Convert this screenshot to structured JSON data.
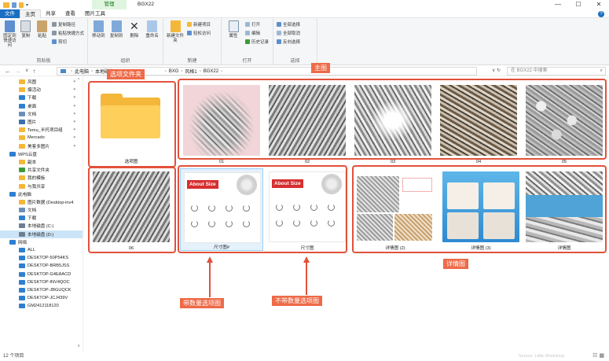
{
  "window": {
    "title": "BGX22",
    "context_tab": "管理",
    "controls": [
      "—",
      "☐",
      "✕"
    ]
  },
  "ribbon_tabs": [
    "文件",
    "主页",
    "共享",
    "查看",
    "图片工具"
  ],
  "ribbon": {
    "clipboard": {
      "label": "剪贴板",
      "big": [
        "固定到快速访问",
        "复制",
        "粘贴"
      ],
      "small": [
        "复制路径",
        "粘贴快捷方式",
        "剪切"
      ]
    },
    "organize": {
      "label": "组织",
      "big": [
        "移动到",
        "复制到",
        "删除",
        "重命名"
      ]
    },
    "new": {
      "label": "新建",
      "big": [
        "新建文件夹"
      ],
      "small": [
        "新建项目",
        "轻松访问"
      ]
    },
    "open": {
      "label": "打开",
      "big": [
        "属性"
      ],
      "small": [
        "打开",
        "编辑",
        "历史记录"
      ]
    },
    "select": {
      "label": "选择",
      "small": [
        "全部选择",
        "全部取消",
        "反向选择"
      ]
    }
  },
  "address": {
    "crumbs": [
      "此电脑",
      "本地磁盘 (",
      "BXG",
      "风格1",
      "BGX22"
    ],
    "search_placeholder": "在 BGX22 中搜索"
  },
  "nav": [
    {
      "label": "风图",
      "icon": "folder",
      "pin": true
    },
    {
      "label": "爆活动",
      "icon": "folder",
      "pin": true
    },
    {
      "label": "下载",
      "icon": "download",
      "pin": true
    },
    {
      "label": "桌面",
      "icon": "desktop",
      "pin": true
    },
    {
      "label": "文档",
      "icon": "doc",
      "pin": true
    },
    {
      "label": "图片",
      "icon": "picture",
      "pin": true
    },
    {
      "label": "Temu_半托项目组",
      "icon": "folder",
      "pin": true
    },
    {
      "label": "Mercado",
      "icon": "folder",
      "pin": true
    },
    {
      "label": "美客多图片",
      "icon": "folder",
      "pin": true
    },
    {
      "label": "WPS云盘",
      "icon": "cloud",
      "level": 0
    },
    {
      "label": "副本",
      "icon": "folder"
    },
    {
      "label": "共享文件夹",
      "icon": "share"
    },
    {
      "label": "我的模板",
      "icon": "folder"
    },
    {
      "label": "与我共享",
      "icon": "folder"
    },
    {
      "label": "此电脑",
      "icon": "pc",
      "level": 0
    },
    {
      "label": "图片数据 (Desktop-inv4",
      "icon": "folder"
    },
    {
      "label": "文档",
      "icon": "doc"
    },
    {
      "label": "下载",
      "icon": "download"
    },
    {
      "label": "本地磁盘 (C:)",
      "icon": "drive"
    },
    {
      "label": "本地磁盘 (D:)",
      "icon": "drive",
      "selected": true
    },
    {
      "label": "网络",
      "icon": "network",
      "level": 0
    },
    {
      "label": "ALL",
      "icon": "pc"
    },
    {
      "label": "DESKTOP-50P54KS",
      "icon": "pc"
    },
    {
      "label": "DESKTOP-BRB5JSS",
      "icon": "pc"
    },
    {
      "label": "DESKTOP-G4EAACD",
      "icon": "pc"
    },
    {
      "label": "DESKTOP-INV4QOC",
      "icon": "pc"
    },
    {
      "label": "DESKTOP-JBGUQCK",
      "icon": "pc"
    },
    {
      "label": "DESKTOP-JCJ439V",
      "icon": "pc"
    },
    {
      "label": "GM2412118120",
      "icon": "pc"
    }
  ],
  "files": [
    {
      "name": "选项图",
      "kind": "folder"
    },
    {
      "name": "01",
      "kind": "pink"
    },
    {
      "name": "02",
      "kind": "grey2"
    },
    {
      "name": "03",
      "kind": "grey3"
    },
    {
      "name": "04",
      "kind": "brown"
    },
    {
      "name": "05",
      "kind": "grey"
    },
    {
      "name": "06",
      "kind": "grey2"
    },
    {
      "name": "尺寸图#",
      "kind": "size",
      "selected": true
    },
    {
      "name": "尺寸图",
      "kind": "size"
    },
    {
      "name": "详情图 (2)",
      "kind": "detail1"
    },
    {
      "name": "详情图 (3)",
      "kind": "detail2"
    },
    {
      "name": "详情图",
      "kind": "detail3"
    }
  ],
  "size_sheet": {
    "header": "About Size"
  },
  "annotations": {
    "folder_tag": "选项文件夹",
    "main_tag": "主图",
    "detail_tag": "详情图",
    "with_qty_tag": "带数量选项图",
    "without_qty_tag": "不带数量选项图"
  },
  "status": {
    "count": "12 个项目",
    "source": "Source: Little Workshop"
  },
  "colors": {
    "accent": "#1a6fc4",
    "annotation": "#e2513a",
    "tag_bg": "#ee6a48",
    "folder": "#f4b73a"
  }
}
